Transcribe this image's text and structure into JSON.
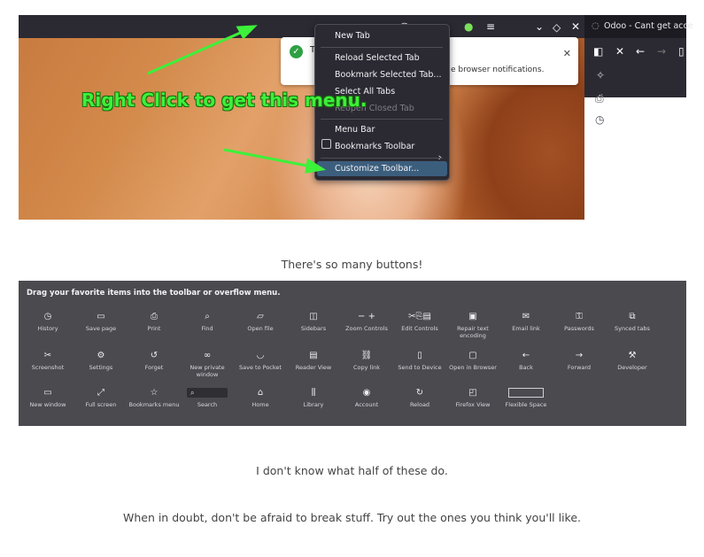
{
  "menu": {
    "items": [
      {
        "label": "New Tab",
        "disabled": false
      },
      {
        "label": "Reload Selected Tab",
        "disabled": false
      },
      {
        "label": "Bookmark Selected Tab...",
        "disabled": false
      },
      {
        "label": "Select All Tabs",
        "disabled": false
      },
      {
        "label": "Reopen Closed Tab",
        "disabled": true
      },
      {
        "label": "Menu Bar",
        "disabled": false
      },
      {
        "label": "Bookmarks Toolbar",
        "disabled": false
      },
      {
        "label": "Customize Toolbar...",
        "disabled": false
      }
    ]
  },
  "notification": {
    "partial_title": "T",
    "message": "e browser notifications."
  },
  "sidebar": {
    "tab_title": "Odoo - Cant get acce"
  },
  "annotation": "Right Click to get this menu.",
  "captions": {
    "c1": "There's so many buttons!",
    "c2": "I don't know what half of these do.",
    "c3": "When in doubt, don't be afraid to break stuff.  Try out the ones you think you'll like."
  },
  "palette": {
    "heading": "Drag your favorite items into the toolbar or overflow menu.",
    "rows": [
      [
        {
          "icon": "history-icon",
          "glyph": "◷",
          "label": "History"
        },
        {
          "icon": "save-page-icon",
          "glyph": "▭",
          "label": "Save page"
        },
        {
          "icon": "print-icon",
          "glyph": "⎙",
          "label": "Print"
        },
        {
          "icon": "find-icon",
          "glyph": "⌕",
          "label": "Find"
        },
        {
          "icon": "open-file-icon",
          "glyph": "▱",
          "label": "Open file"
        },
        {
          "icon": "sidebars-icon",
          "glyph": "◫",
          "label": "Sidebars"
        },
        {
          "icon": "zoom-controls-icon",
          "glyph": "−  +",
          "label": "Zoom Controls"
        },
        {
          "icon": "edit-controls-icon",
          "glyph": "✂⎘▤",
          "label": "Edit Controls"
        },
        {
          "icon": "repair-text-encoding-icon",
          "glyph": "▣",
          "label": "Repair text encoding"
        },
        {
          "icon": "email-link-icon",
          "glyph": "✉",
          "label": "Email link"
        },
        {
          "icon": "passwords-icon",
          "glyph": "⚿",
          "label": "Passwords"
        },
        {
          "icon": "synced-tabs-icon",
          "glyph": "⧉",
          "label": "Synced tabs"
        }
      ],
      [
        {
          "icon": "screenshot-icon",
          "glyph": "✂",
          "label": "Screenshot"
        },
        {
          "icon": "settings-icon",
          "glyph": "⚙",
          "label": "Settings"
        },
        {
          "icon": "forget-icon",
          "glyph": "↺",
          "label": "Forget"
        },
        {
          "icon": "new-private-window-icon",
          "glyph": "∞",
          "label": "New private window"
        },
        {
          "icon": "save-to-pocket-icon",
          "glyph": "◡",
          "label": "Save to Pocket"
        },
        {
          "icon": "reader-view-icon",
          "glyph": "▤",
          "label": "Reader View"
        },
        {
          "icon": "copy-link-icon",
          "glyph": "⛓",
          "label": "Copy link"
        },
        {
          "icon": "send-to-device-icon",
          "glyph": "▯",
          "label": "Send to Device"
        },
        {
          "icon": "open-in-browser-icon",
          "glyph": "▢",
          "label": "Open in Browser"
        },
        {
          "icon": "back-icon",
          "glyph": "←",
          "label": "Back"
        },
        {
          "icon": "forward-icon",
          "glyph": "→",
          "label": "Forward"
        },
        {
          "icon": "developer-icon",
          "glyph": "⚒",
          "label": "Developer"
        }
      ],
      [
        {
          "icon": "new-window-icon",
          "glyph": "▭",
          "label": "New window"
        },
        {
          "icon": "full-screen-icon",
          "glyph": "⤢",
          "label": "Full screen"
        },
        {
          "icon": "bookmarks-menu-icon",
          "glyph": "☆",
          "label": "Bookmarks menu"
        },
        {
          "icon": "search-icon",
          "glyph": "⌕",
          "label": "Search",
          "kind": "search"
        },
        {
          "icon": "home-icon",
          "glyph": "⌂",
          "label": "Home"
        },
        {
          "icon": "library-icon",
          "glyph": "⫼",
          "label": "Library"
        },
        {
          "icon": "account-icon",
          "glyph": "◉",
          "label": "Account"
        },
        {
          "icon": "reload-icon",
          "glyph": "↻",
          "label": "Reload"
        },
        {
          "icon": "firefox-view-icon",
          "glyph": "◰",
          "label": "Firefox View"
        },
        {
          "icon": "flexible-space-icon",
          "glyph": "",
          "label": "Flexible Space",
          "kind": "flex"
        }
      ]
    ]
  },
  "colors": {
    "annotation_green": "#3df03a",
    "menu_bg": "#2b2a33",
    "menu_highlight": "#3c5e7d",
    "palette_bg": "#4a4a4f"
  }
}
